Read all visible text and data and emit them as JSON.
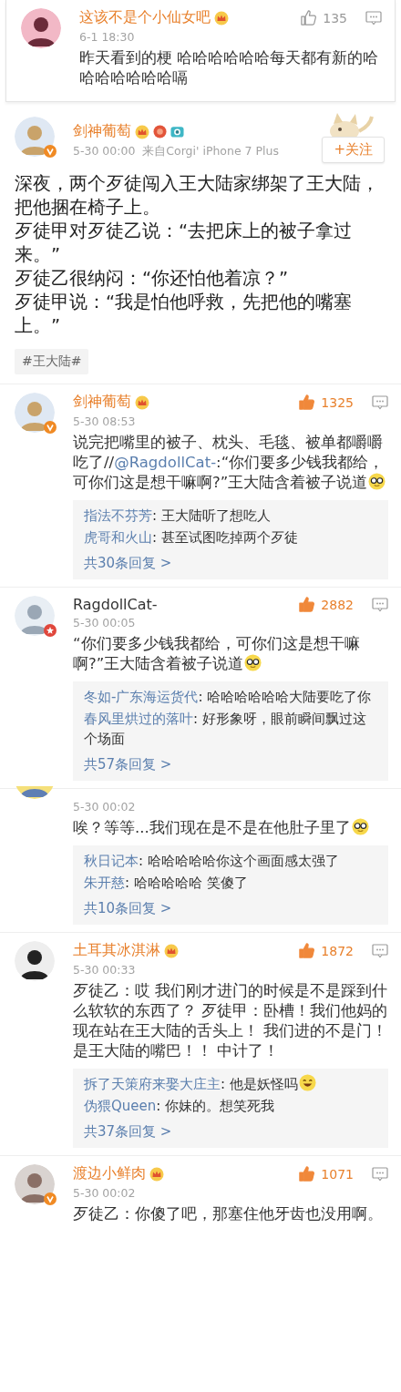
{
  "top_comment": {
    "kind": "comment",
    "name": "这该不是个小仙女吧",
    "vip": true,
    "liked": false,
    "likes": "135",
    "time": "6-1 18:30",
    "text": [
      {
        "kind": "plain",
        "text": "昨天看到的梗 哈哈哈哈哈哈每天都有新的哈哈哈哈哈哈哈嗝"
      }
    ]
  },
  "post": {
    "name": "剑神葡萄",
    "vip": true,
    "avatar_badge": {
      "kind": "verified"
    },
    "time": "5-30 00:00",
    "source": "来自Corgi' iPhone 7 Plus",
    "follow": "+关注",
    "paragraphs": [
      "深夜，两个歹徒闯入王大陆家绑架了王大陆，把他捆在椅子上。",
      "歹徒甲对歹徒乙说：“去把床上的被子拿过来。”",
      "歹徒乙很纳闷：“你还怕他着凉？”",
      "歹徒甲说：“我是怕他呼救，先把他的嘴塞上。”"
    ],
    "hashtag": "#王大陆#"
  },
  "comments": [
    {
      "kind": "comment",
      "name": "剑神葡萄",
      "vip": true,
      "avatar_badge": {
        "kind": "verified"
      },
      "liked": true,
      "likes": "1325",
      "time": "5-30 08:53",
      "text": [
        {
          "kind": "plain",
          "text": "说完把嘴里的被子、枕头、毛毯、被单都嚼嚼吃了//"
        },
        {
          "kind": "mention",
          "text": "@RagdollCat-"
        },
        {
          "kind": "plain",
          "text": ":“你们要多少钱我都给，可你们这是想干嘛啊?”王大陆含着被子说道"
        }
      ],
      "emoji": {
        "kind": "glasses"
      },
      "replies": [
        {
          "author": "指法不芬芳",
          "text": ": 王大陆听了想吃人"
        },
        {
          "author": "虎哥和火山",
          "text": ": 甚至试图吃掉两个歹徒"
        }
      ],
      "more": "共30条回复 >"
    },
    {
      "kind": "comment",
      "name": "RagdollCat-",
      "vip": false,
      "avatar_badge": {
        "kind": "star"
      },
      "liked": true,
      "likes": "2882",
      "time": "5-30 00:05",
      "text": [
        {
          "kind": "plain",
          "text": "“你们要多少钱我都给，可你们这是想干嘛啊?”王大陆含着被子说道"
        }
      ],
      "emoji": {
        "kind": "glasses"
      },
      "replies": [
        {
          "author": "冬如-广东海运货代",
          "text": ": 哈哈哈哈哈哈大陆要吃了你"
        },
        {
          "author": "春风里烘过的落叶",
          "text": ": 好形象呀，眼前瞬间飘过这个场面"
        }
      ],
      "more": "共57条回复 >"
    },
    {
      "kind": "cropped",
      "time": "5-30 00:02",
      "text": [
        {
          "kind": "plain",
          "text": "唉？等等...我们现在是不是在他肚子里了"
        }
      ],
      "emoji": {
        "kind": "glasses"
      },
      "replies": [
        {
          "author": "秋日记本",
          "text": ": 哈哈哈哈哈你这个画面感太强了"
        },
        {
          "author": "朱开慈",
          "text": ": 哈哈哈哈哈 笑傻了"
        }
      ],
      "more": "共10条回复 >"
    },
    {
      "kind": "comment",
      "name": "土耳其冰淇淋",
      "vip": true,
      "liked": true,
      "likes": "1872",
      "time": "5-30 00:33",
      "text": [
        {
          "kind": "plain",
          "text": "歹徒乙：哎 我们刚才进门的时候是不是踩到什么软软的东西了？ 歹徒甲：卧槽！我们他妈的现在站在王大陆的舌头上！ 我们进的不是门！是王大陆的嘴巴！！ 中计了！"
        }
      ],
      "replies": [
        {
          "author": "拆了天策府来娶大庄主",
          "text": ": 他是妖怪吗",
          "emoji": {
            "kind": "laugh"
          }
        },
        {
          "author": "伪猥Queen",
          "text": ": 你妹的。想笑死我"
        }
      ],
      "more": "共37条回复 >"
    },
    {
      "kind": "comment",
      "name": "渡边小鲜肉",
      "vip": true,
      "avatar_badge": {
        "kind": "verified"
      },
      "liked": true,
      "likes": "1071",
      "time": "5-30 00:02",
      "text": [
        {
          "kind": "plain",
          "text": "歹徒乙：你傻了吧，那塞住他牙齿也没用啊。"
        }
      ]
    }
  ]
}
